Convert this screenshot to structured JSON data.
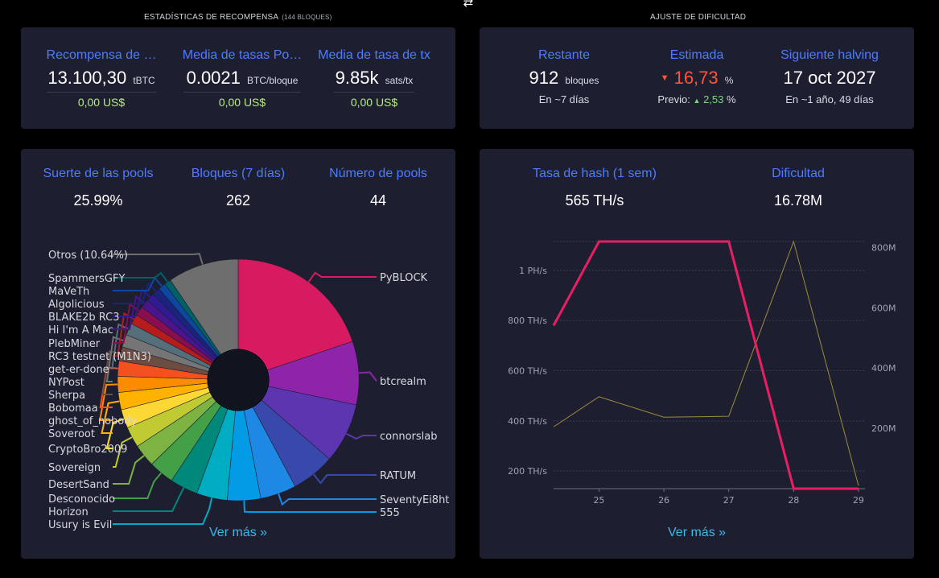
{
  "toggle_icon": "swap-arrows-icon",
  "reward": {
    "section_title": "ESTADÍSTICAS DE RECOMPENSA",
    "section_subtitle": "(144 BLOQUES)",
    "items": [
      {
        "title": "Recompensa de …",
        "value": "13.100,30",
        "unit": "tBTC",
        "fiat": "0,00 US$"
      },
      {
        "title": "Media de tasas Po…",
        "value": "0.0021",
        "unit": "BTC/bloque",
        "fiat": "0,00 US$"
      },
      {
        "title": "Media de tasa de tx",
        "value": "9.85k",
        "unit": "sats/tx",
        "fiat": "0,00 US$"
      }
    ]
  },
  "difficulty": {
    "section_title": "AJUSTE DE DIFICULTAD",
    "remaining": {
      "title": "Restante",
      "value": "912",
      "unit": "bloques",
      "sub": "En ~7 días"
    },
    "estimated": {
      "title": "Estimada",
      "arrow": "▼",
      "value": "16,73",
      "unit": "%",
      "prev_label": "Previo:",
      "prev_arrow": "▲",
      "prev_value": "2,53",
      "prev_unit": "%"
    },
    "halving": {
      "title": "Siguiente halving",
      "value": "17 oct 2027",
      "sub": "En ~1 año, 49 días"
    }
  },
  "pools": {
    "stats": [
      {
        "title": "Suerte de las pools",
        "value": "25.99%"
      },
      {
        "title": "Bloques (7 días)",
        "value": "262"
      },
      {
        "title": "Número de pools",
        "value": "44"
      }
    ],
    "see_more": "Ver más »"
  },
  "hashrate": {
    "stats": [
      {
        "title": "Tasa de hash (1 sem)",
        "value": "565 TH/s"
      },
      {
        "title": "Dificultad",
        "value": "16.78M"
      }
    ],
    "see_more": "Ver más »"
  },
  "chart_data": [
    {
      "type": "pie",
      "title": "",
      "slices": [
        {
          "name": "PyBLOCK",
          "value": 22.2,
          "color": "#d81b60",
          "label_side": "right",
          "label_y": 344
        },
        {
          "name": "btcrealm",
          "value": 9.5,
          "color": "#8e24aa",
          "label_side": "right",
          "label_y": 473
        },
        {
          "name": "connorslab",
          "value": 9.0,
          "color": "#5e35b1",
          "label_side": "right",
          "label_y": 541
        },
        {
          "name": "RATUM",
          "value": 6.5,
          "color": "#3949ab",
          "label_side": "right",
          "label_y": 590
        },
        {
          "name": "SeventyEi8ht",
          "value": 5.4,
          "color": "#1e88e5",
          "label_side": "right",
          "label_y": 620
        },
        {
          "name": "555",
          "value": 5.0,
          "color": "#039be5",
          "label_side": "right",
          "label_y": 636
        },
        {
          "name": "Usury is Evil",
          "value": 4.6,
          "color": "#00acc1",
          "label_side": "left",
          "label_y": 651
        },
        {
          "name": "Horizon",
          "value": 4.2,
          "color": "#00897b",
          "label_side": "left",
          "label_y": 635
        },
        {
          "name": "Desconocido",
          "value": 3.8,
          "color": "#43a047",
          "label_side": "left",
          "label_y": 619
        },
        {
          "name": "DesertSand",
          "value": 3.4,
          "color": "#7cb342",
          "label_side": "left",
          "label_y": 601
        },
        {
          "name": "Sovereign",
          "value": 3.1,
          "color": "#c0ca33",
          "label_side": "left",
          "label_y": 580
        },
        {
          "name": "CryptoBro2009",
          "value": 2.8,
          "color": "#fdd835",
          "label_side": "left",
          "label_y": 557
        },
        {
          "name": "Soveroot",
          "value": 2.6,
          "color": "#ffb300",
          "label_side": "left",
          "label_y": 538
        },
        {
          "name": "ghost_of_nobody",
          "value": 2.4,
          "color": "#fb8c00",
          "label_side": "left",
          "label_y": 522
        },
        {
          "name": "Bobomaa",
          "value": 2.3,
          "color": "#f4511e",
          "label_side": "left",
          "label_y": 506
        },
        {
          "name": "Sherpa",
          "value": 2.1,
          "color": "#6d4c41",
          "label_side": "left",
          "label_y": 490
        },
        {
          "name": "NYPost",
          "value": 1.9,
          "color": "#757575",
          "label_side": "left",
          "label_y": 474
        },
        {
          "name": "get-er-done",
          "value": 1.8,
          "color": "#546e7a",
          "label_side": "left",
          "label_y": 458
        },
        {
          "name": "RC3 testnet (M1N3)",
          "value": 1.5,
          "color": "#b71c1c",
          "label_side": "left",
          "label_y": 442
        },
        {
          "name": "PlebMiner",
          "value": 1.4,
          "color": "#880e4f",
          "label_side": "left",
          "label_y": 426
        },
        {
          "name": "Hi I'm A Mac",
          "value": 1.3,
          "color": "#4a148c",
          "label_side": "left",
          "label_y": 409
        },
        {
          "name": "BLAKE2b RC3",
          "value": 1.2,
          "color": "#311b92",
          "label_side": "left",
          "label_y": 393
        },
        {
          "name": "Algolicious",
          "value": 1.2,
          "color": "#1a237e",
          "label_side": "left",
          "label_y": 377
        },
        {
          "name": "MaVeTh",
          "value": 1.1,
          "color": "#0d47a1",
          "label_side": "left",
          "label_y": 361
        },
        {
          "name": "SpammersGFY",
          "value": 1.0,
          "color": "#006064",
          "label_side": "left",
          "label_y": 345
        },
        {
          "name": "Otros (10.64%)",
          "value": 10.64,
          "color": "#6e6e6e",
          "label_side": "left",
          "label_y": 316
        }
      ]
    },
    {
      "type": "line",
      "title": "",
      "x": [
        24.3,
        25,
        26,
        27,
        28,
        29
      ],
      "x_ticks": [
        "25",
        "26",
        "27",
        "28",
        "29"
      ],
      "x_tick_values": [
        25,
        26,
        27,
        28,
        29
      ],
      "xlim": [
        24.3,
        29.1
      ],
      "y_left_ticks": [
        "200 TH/s",
        "400 TH/s",
        "600 TH/s",
        "800 TH/s",
        "1 PH/s"
      ],
      "y_left_tick_values": [
        200,
        400,
        600,
        800,
        1000
      ],
      "y_left_lim": [
        130,
        1115
      ],
      "y_right_ticks": [
        "200M",
        "400M",
        "600M",
        "800M"
      ],
      "y_right_tick_values": [
        200,
        400,
        600,
        800
      ],
      "y_right_lim": [
        0,
        820
      ],
      "series": [
        {
          "axis": "left",
          "color": "#e91e63",
          "width": 3,
          "values": [
            780,
            1115,
            1115,
            1115,
            130,
            130
          ]
        },
        {
          "axis": "right",
          "color": "#a08a3a",
          "width": 1,
          "values": [
            205,
            305,
            237,
            240,
            820,
            10
          ]
        }
      ]
    }
  ]
}
